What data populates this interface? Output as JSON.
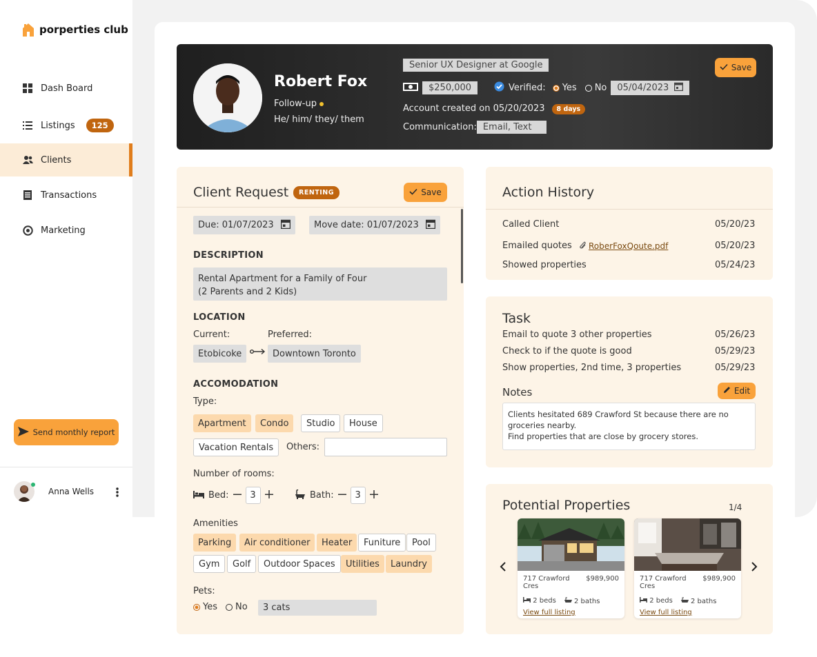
{
  "app": {
    "logo_text": "porperties club"
  },
  "sidebar": {
    "items": [
      {
        "label": "Dash Board",
        "icon": "grid-icon"
      },
      {
        "label": "Listings",
        "icon": "list-icon",
        "badge": "125"
      },
      {
        "label": "Clients",
        "icon": "users-icon",
        "active": true
      },
      {
        "label": "Transactions",
        "icon": "receipt-icon"
      },
      {
        "label": "Marketing",
        "icon": "target-icon"
      }
    ],
    "report_button": "Send monthly report",
    "user_name": "Anna Wells"
  },
  "profile": {
    "name": "Robert Fox",
    "status": "Follow-up",
    "pronouns": "He/ him/ they/ them",
    "job": "Senior UX Designer at Google",
    "budget": "$250,000",
    "verified_label": "Verified:",
    "yes": "Yes",
    "no": "No",
    "verified_date": "05/04/2023",
    "account_created": "Account created on 05/20/2023",
    "days_badge": "8 days",
    "communication_label": "Communication:",
    "communication_value": "Email, Text",
    "save_label": "Save"
  },
  "request": {
    "title": "Client Request",
    "badge": "RENTING",
    "save_label": "Save",
    "due": "Due: 01/07/2023",
    "move_date": "Move date: 01/07/2023",
    "description_heading": "DESCRIPTION",
    "description_line1": "Rental Apartment for a Family of Four",
    "description_line2": "(2 Parents and 2 Kids)",
    "location_heading": "LOCATION",
    "current_label": "Current:",
    "preferred_label": "Preferred:",
    "current_value": "Etobicoke",
    "preferred_value": "Downtown Toronto",
    "accommodation_heading": "ACCOMODATION",
    "type_label": "Type:",
    "types": [
      "Apartment",
      "Condo",
      "Studio",
      "House",
      "Vacation Rentals"
    ],
    "others_label": "Others:",
    "rooms_label": "Number of rooms:",
    "bed_label": "Bed:",
    "bed_count": "3",
    "bath_label": "Bath:",
    "bath_count": "3",
    "amenities_label": "Amenities",
    "amenities": [
      "Parking",
      "Air conditioner",
      "Heater",
      "Funiture",
      "Pool",
      "Gym",
      "Golf",
      "Outdoor Spaces",
      "Utilities",
      "Laundry"
    ],
    "pets_label": "Pets:",
    "pets_yes": "Yes",
    "pets_no": "No",
    "pets_value": "3 cats"
  },
  "history": {
    "title": "Action History",
    "rows": [
      {
        "action": "Called Client",
        "date": "05/20/23"
      },
      {
        "action": "Emailed quotes",
        "attachment": "RoberFoxQoute.pdf",
        "date": "05/20/23"
      },
      {
        "action": "Showed properties",
        "date": "05/24/23"
      }
    ]
  },
  "task": {
    "title": "Task",
    "rows": [
      {
        "text": "Email to quote 3 other properties",
        "date": "05/26/23"
      },
      {
        "text": "Check to if the quote is good",
        "date": "05/29/23"
      },
      {
        "text": "Show properties, 2nd time, 3 properties",
        "date": "05/29/23"
      }
    ],
    "notes_label": "Notes",
    "edit_label": "Edit",
    "notes_line1": "Clients hesitated 689 Crawford St because there are no groceries nearby.",
    "notes_line2": "Find properties that are close by grocery stores."
  },
  "properties": {
    "title": "Potential Properties",
    "pager": "1/4",
    "cards": [
      {
        "address": "717 Crawford Cres",
        "price": "$989,900",
        "beds": "2 beds",
        "baths": "2 baths",
        "link": "View full listing"
      },
      {
        "address": "717 Crawford Cres",
        "price": "$989,900",
        "beds": "2 beds",
        "baths": "2 baths",
        "link": "View full listing"
      }
    ]
  },
  "colors": {
    "accent": "#f9a23b",
    "accent_dark": "#c0650f",
    "panel": "#fdf4e7",
    "header": "#2a2a2a"
  }
}
